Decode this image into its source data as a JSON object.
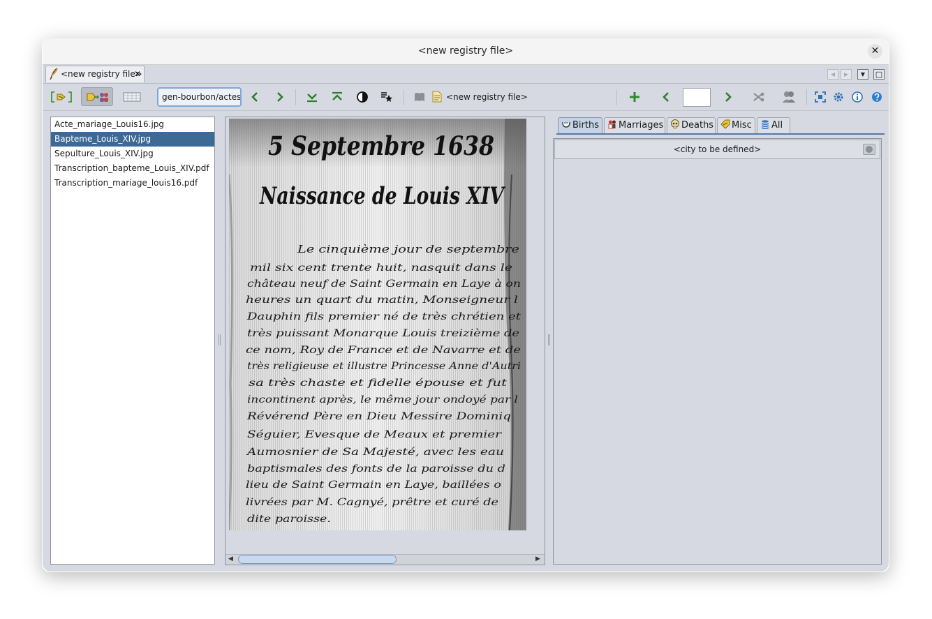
{
  "window": {
    "title": "<new registry file>",
    "close_symbol": "✕"
  },
  "doc_tabs": [
    {
      "label": "<new registry file>",
      "close_symbol": "✕"
    }
  ],
  "tab_nav": {
    "prev_symbol": "◀",
    "next_symbol": "▶",
    "menu_symbol": "▼",
    "maximize_symbol": "□"
  },
  "toolbar": {
    "path_value": "gen-bourbon/actes",
    "document_label": "<new registry file>",
    "page_value": ""
  },
  "file_list": {
    "items": [
      "Acte_mariage_Louis16.jpg",
      "Bapteme_Louis_XIV.jpg",
      "Sepulture_Louis_XIV.jpg",
      "Transcription_bapteme_Louis_XIV.pdf",
      "Transcription_mariage_louis16.pdf"
    ],
    "selected_index": 1
  },
  "scan": {
    "date_heading": "5 Septembre 1638",
    "title_heading": "Naissance de Louis XIV",
    "lines": [
      "Le cinquième jour de septembre",
      "mil six cent trente huit, nasquit dans le",
      "château neuf de Saint Germain en Laye à on",
      "heures un quart du matin, Monseigneur l",
      "Dauphin fils premier né de très chrétien et",
      "très puissant Monarque Louis treizième de",
      "ce nom, Roy de France et de Navarre et de",
      "très religieuse et illustre Princesse Anne d'Autri",
      "sa très chaste et fidelle épouse et fut",
      "incontinent après, le même jour ondoyé par l",
      "Révérend Père en Dieu Messire Dominiq",
      "Séguier, Evesque de Meaux et premier",
      "Aumosnier de Sa Majesté, avec les eau",
      "baptismales des fonts de la paroisse du d",
      "lieu de Saint Germain en Laye, baillées o",
      "livrées par M. Cagnyé, prêtre et curé de",
      "dite paroisse."
    ]
  },
  "viewer_scroll": {
    "left_symbol": "◀",
    "right_symbol": "▶"
  },
  "record_tabs": [
    {
      "label": "Births",
      "active": true
    },
    {
      "label": "Marriages",
      "active": false
    },
    {
      "label": "Deaths",
      "active": false
    },
    {
      "label": "Misc",
      "active": false
    },
    {
      "label": "All",
      "active": false
    }
  ],
  "city": {
    "label": "<city to be defined>"
  },
  "colors": {
    "accent_blue": "#3d6a95",
    "green_icons": "#2e8b2e",
    "window_bg": "#d6d9e1"
  }
}
